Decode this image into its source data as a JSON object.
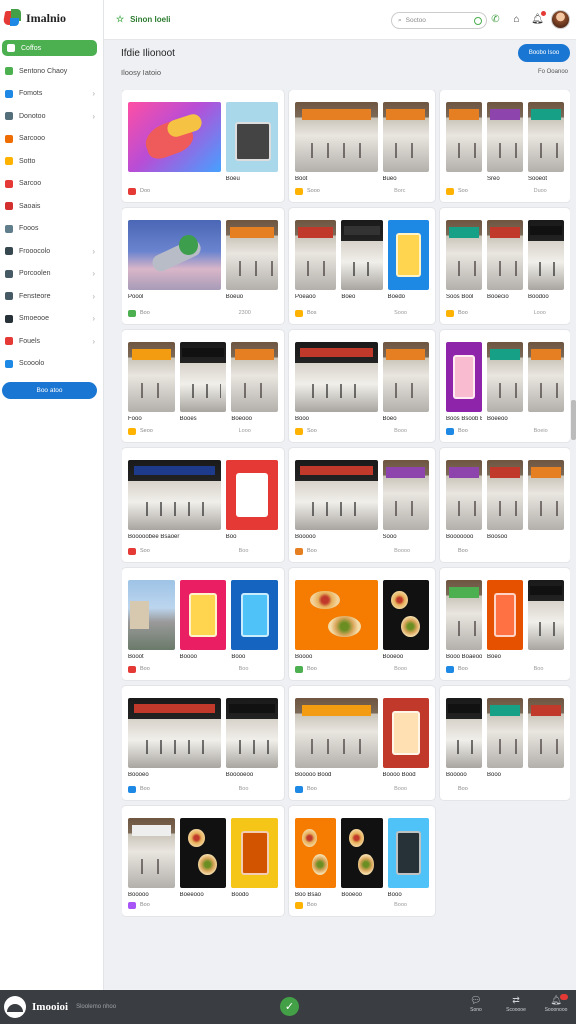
{
  "brand": {
    "name": "Imalnio",
    "tagline": ""
  },
  "sidebar": {
    "items": [
      {
        "label": "Coffos",
        "color": "#2e7d32",
        "active": true
      },
      {
        "label": "Sentono Chaoy",
        "color": "#4caf50"
      },
      {
        "label": "Fomots",
        "color": "#1e88e5",
        "chevron": true
      },
      {
        "label": "Donotoo",
        "color": "#546e7a",
        "chevron": true
      },
      {
        "label": "Sarcooo",
        "color": "#ef6c00"
      },
      {
        "label": "Sotto",
        "color": "#ffb300"
      },
      {
        "label": "Sarcoo",
        "color": "#e53935"
      },
      {
        "label": "Saoais",
        "color": "#d32f2f"
      },
      {
        "label": "Fooos",
        "color": "#607d8b"
      },
      {
        "label": "Frooocolo",
        "color": "#37474f",
        "chevron": true
      },
      {
        "label": "Porcoolen",
        "color": "#455a64",
        "chevron": true
      },
      {
        "label": "Fensteore",
        "color": "#455a64",
        "chevron": true
      },
      {
        "label": "Smoeooe",
        "color": "#263238",
        "chevron": true
      },
      {
        "label": "Fouels",
        "color": "#e53935",
        "chevron": true
      },
      {
        "label": "Scooolo",
        "color": "#1e88e5"
      }
    ],
    "button_label": "Boo atoo"
  },
  "topbar": {
    "title": "Sinon Ioeli",
    "search_placeholder": "Soctoo"
  },
  "page": {
    "title": "Ifdie Ilionoot",
    "subtitle": "Iloosy Iatoio",
    "button_label": "Boobo Isoo",
    "link_label": "Fo Ooanoo"
  },
  "cards": [
    {
      "titles": [
        "",
        "Boeu",
        ""
      ],
      "meta": [
        "Doo",
        "Soos"
      ],
      "chip": "#e53935",
      "count": ""
    },
    {
      "titles": [
        "Boot",
        "Bueo",
        "Deedo"
      ],
      "meta": [
        "Sooo",
        "1300"
      ],
      "chip": "#ffb300",
      "count": "Borc"
    },
    {
      "titles": [
        "",
        "Sreo",
        "Sooeot"
      ],
      "meta": [
        "Soo",
        "Boou"
      ],
      "chip": "#ffb300",
      "count": "Duoo"
    },
    {
      "titles": [
        "Poool",
        "Boeuo",
        ""
      ],
      "meta": [
        "Boo",
        "Sooo"
      ],
      "chip": "#4caf50",
      "count": "2300"
    },
    {
      "titles": [
        "Poeaoo",
        "Boeo",
        "Boedo"
      ],
      "meta": [
        "Bos",
        "1300"
      ],
      "chip": "#ffb300",
      "count": "Sooo"
    },
    {
      "titles": [
        "Soos Bool",
        "Booecio",
        "Boodoo"
      ],
      "meta": [
        "Boo",
        "Doe"
      ],
      "chip": "#ffb300",
      "count": "Looo"
    },
    {
      "titles": [
        "Fooo",
        "Booes",
        "Boeooo"
      ],
      "meta": [
        "Seoo",
        "Dooo"
      ],
      "chip": "#ffb300",
      "count": "Looo"
    },
    {
      "titles": [
        "Booo",
        "Boeo",
        "Boooo"
      ],
      "meta": [
        "Soo",
        "Booo"
      ],
      "chip": "#ffb300",
      "count": "Booo"
    },
    {
      "titles": [
        "Boos Bsoob Boody",
        "Boeeoo",
        ""
      ],
      "meta": [
        "Boo",
        "Booo"
      ],
      "chip": "#1e88e5",
      "count": "Boeio"
    },
    {
      "titles": [
        "Booooobee Bsaoer",
        "Boo"
      ],
      "meta": [
        "Soo",
        "Boo"
      ],
      "chip": "#e53935",
      "count": "Boo"
    },
    {
      "titles": [
        "Booooo",
        "Sooo",
        "Boooo"
      ],
      "meta": [
        "Boo",
        "Boo"
      ],
      "chip": "#e67e22",
      "count": "Boooo"
    },
    {
      "titles": [
        "Booooooo",
        "Boosoo",
        ""
      ],
      "meta": [
        "Boo",
        ""
      ],
      "chip": "",
      "count": ""
    },
    {
      "titles": [
        "Booot",
        "Boooo",
        "Booo"
      ],
      "meta": [
        "Boo",
        "Boo"
      ],
      "chip": "#e53935",
      "count": "Boo"
    },
    {
      "titles": [
        "Boooo",
        "Booeoo",
        "Boooeo"
      ],
      "meta": [
        "Boo",
        "Boo"
      ],
      "chip": "#4caf50",
      "count": "Booo"
    },
    {
      "titles": [
        "Booo Boaeooooo Bodo",
        "Boeo"
      ],
      "meta": [
        "Boo",
        "Booo"
      ],
      "chip": "#1e88e5",
      "count": "Boo"
    },
    {
      "titles": [
        "Boooeo",
        "Booooeoo",
        "Boo"
      ],
      "meta": [
        "Boo",
        "Boo"
      ],
      "chip": "#1e88e5",
      "count": "Boo"
    },
    {
      "titles": [
        "Booooo Bood",
        "Boooo Bood",
        "Booe"
      ],
      "meta": [
        "Boo",
        "Boo"
      ],
      "chip": "#1e88e5",
      "count": "Booo"
    },
    {
      "titles": [
        "Booooo",
        "Booo"
      ],
      "meta": [
        "Boo",
        ""
      ],
      "chip": "",
      "count": ""
    },
    {
      "titles": [
        "Booooo",
        "Boeeooo",
        "Boodo"
      ],
      "meta": [
        "Boo",
        "Boo"
      ],
      "chip": "#a855f7",
      "count": ""
    },
    {
      "titles": [
        "Boo Bsao",
        "Booeoo",
        "Booo"
      ],
      "meta": [
        "Boo",
        "Boo"
      ],
      "chip": "#ffb300",
      "count": "Booo"
    }
  ],
  "bottombar": {
    "name": "Imooioi",
    "subtitle": "Sloolemo nhoo",
    "actions": [
      {
        "label": "Sono",
        "icon": "chat-icon"
      },
      {
        "label": "Scooooe",
        "icon": "swap-icon"
      },
      {
        "label": "Sooonooo",
        "icon": "bell-icon"
      }
    ]
  }
}
